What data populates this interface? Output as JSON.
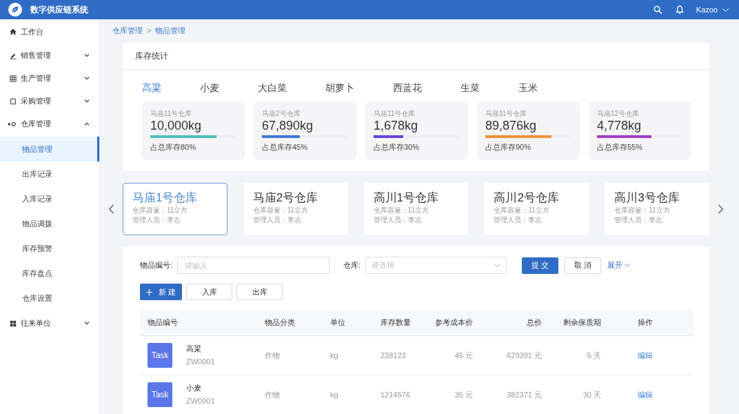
{
  "header": {
    "title": "数字供应链系统",
    "user": "Kazoo"
  },
  "sidebar": {
    "items": [
      {
        "label": "工作台",
        "kind": "link"
      },
      {
        "label": "销售管理",
        "kind": "group",
        "expanded": false
      },
      {
        "label": "生产管理",
        "kind": "group",
        "expanded": false
      },
      {
        "label": "采购管理",
        "kind": "group",
        "expanded": false
      },
      {
        "label": "仓库管理",
        "kind": "group",
        "expanded": true,
        "children": [
          {
            "label": "物品管理",
            "selected": true
          },
          {
            "label": "出库记录",
            "selected": false
          },
          {
            "label": "入库记录",
            "selected": false
          },
          {
            "label": "物品调拨",
            "selected": false
          },
          {
            "label": "库存预警",
            "selected": false
          },
          {
            "label": "库存盘点",
            "selected": false
          },
          {
            "label": "仓库设置",
            "selected": false
          }
        ]
      },
      {
        "label": "往来单位",
        "kind": "group",
        "expanded": false
      }
    ]
  },
  "breadcrumb": {
    "items": [
      "仓库管理",
      "物品管理"
    ],
    "separator": ">"
  },
  "stats": {
    "title": "库存统计",
    "tabs": [
      {
        "label": "高粱",
        "selected": true
      },
      {
        "label": "小麦",
        "selected": false
      },
      {
        "label": "大白菜",
        "selected": false
      },
      {
        "label": "胡萝卜",
        "selected": false
      },
      {
        "label": "西蓝花",
        "selected": false
      },
      {
        "label": "生菜",
        "selected": false
      },
      {
        "label": "玉米",
        "selected": false
      }
    ],
    "cards": [
      {
        "warehouse": "马庙11号仓库",
        "amount": "10,000kg",
        "level": 0.79,
        "color": "#4cbfbd",
        "share": "占总库存80%"
      },
      {
        "warehouse": "马庙2号仓库",
        "amount": "67,890kg",
        "level": 0.45,
        "color": "#3f79d9",
        "share": "占总库存45%"
      },
      {
        "warehouse": "马庙11号仓库",
        "amount": "1,678kg",
        "level": 0.35,
        "color": "#6b42dc",
        "share": "占总库存30%"
      },
      {
        "warehouse": "马庙11号仓库",
        "amount": "89,876kg",
        "level": 0.79,
        "color": "#f0903a",
        "share": "占总库存90%"
      },
      {
        "warehouse": "马庙12号仓库",
        "amount": "4,778kg",
        "level": 0.65,
        "color": "#a23dc2",
        "share": "占总库存55%"
      }
    ]
  },
  "warehouses": {
    "items": [
      {
        "name": "马庙1号仓库",
        "capacity": "仓库容量：11立方",
        "manager": "管理人员：李志",
        "selected": true
      },
      {
        "name": "马庙2号仓库",
        "capacity": "仓库容量：11立方",
        "manager": "管理人员：李志",
        "selected": false
      },
      {
        "name": "高川1号仓库",
        "capacity": "仓库容量：11立方",
        "manager": "管理人员：李志",
        "selected": false
      },
      {
        "name": "高川2号仓库",
        "capacity": "仓库容量：11立方",
        "manager": "管理人员：李志",
        "selected": false
      },
      {
        "name": "高川3号仓库",
        "capacity": "仓库容量：11立方",
        "manager": "管理人员：李志",
        "selected": false
      }
    ]
  },
  "filter": {
    "fields": [
      {
        "kind": "input",
        "label": "物品编号:",
        "placeholder": "请输入"
      },
      {
        "kind": "select",
        "label": "仓库:",
        "placeholder": "请选择"
      }
    ],
    "submit": "提 交",
    "cancel": "取 消",
    "expand": "展开"
  },
  "actions": [
    {
      "kind": "create",
      "label": "新 建"
    },
    {
      "kind": "default",
      "label": "入库"
    },
    {
      "kind": "default",
      "label": "出库"
    }
  ],
  "table": {
    "columns": [
      "物品编号",
      "物品分类",
      "单位",
      "库存数量",
      "参考成本价",
      "总价",
      "剩余保质期",
      "操作"
    ],
    "rows": [
      {
        "tag": "Task",
        "name": "高粱",
        "code": "ZW0001",
        "category": "作物",
        "unit": "kg",
        "stock": "238123",
        "cost": "45 元",
        "total": "629391 元",
        "shelf_life": "5 天",
        "action": "编辑"
      },
      {
        "tag": "Task",
        "name": "小麦",
        "code": "ZW0001",
        "category": "作物",
        "unit": "kg",
        "stock": "1214576",
        "cost": "35 元",
        "total": "382371 元",
        "shelf_life": "30 天",
        "action": "编辑"
      }
    ]
  }
}
